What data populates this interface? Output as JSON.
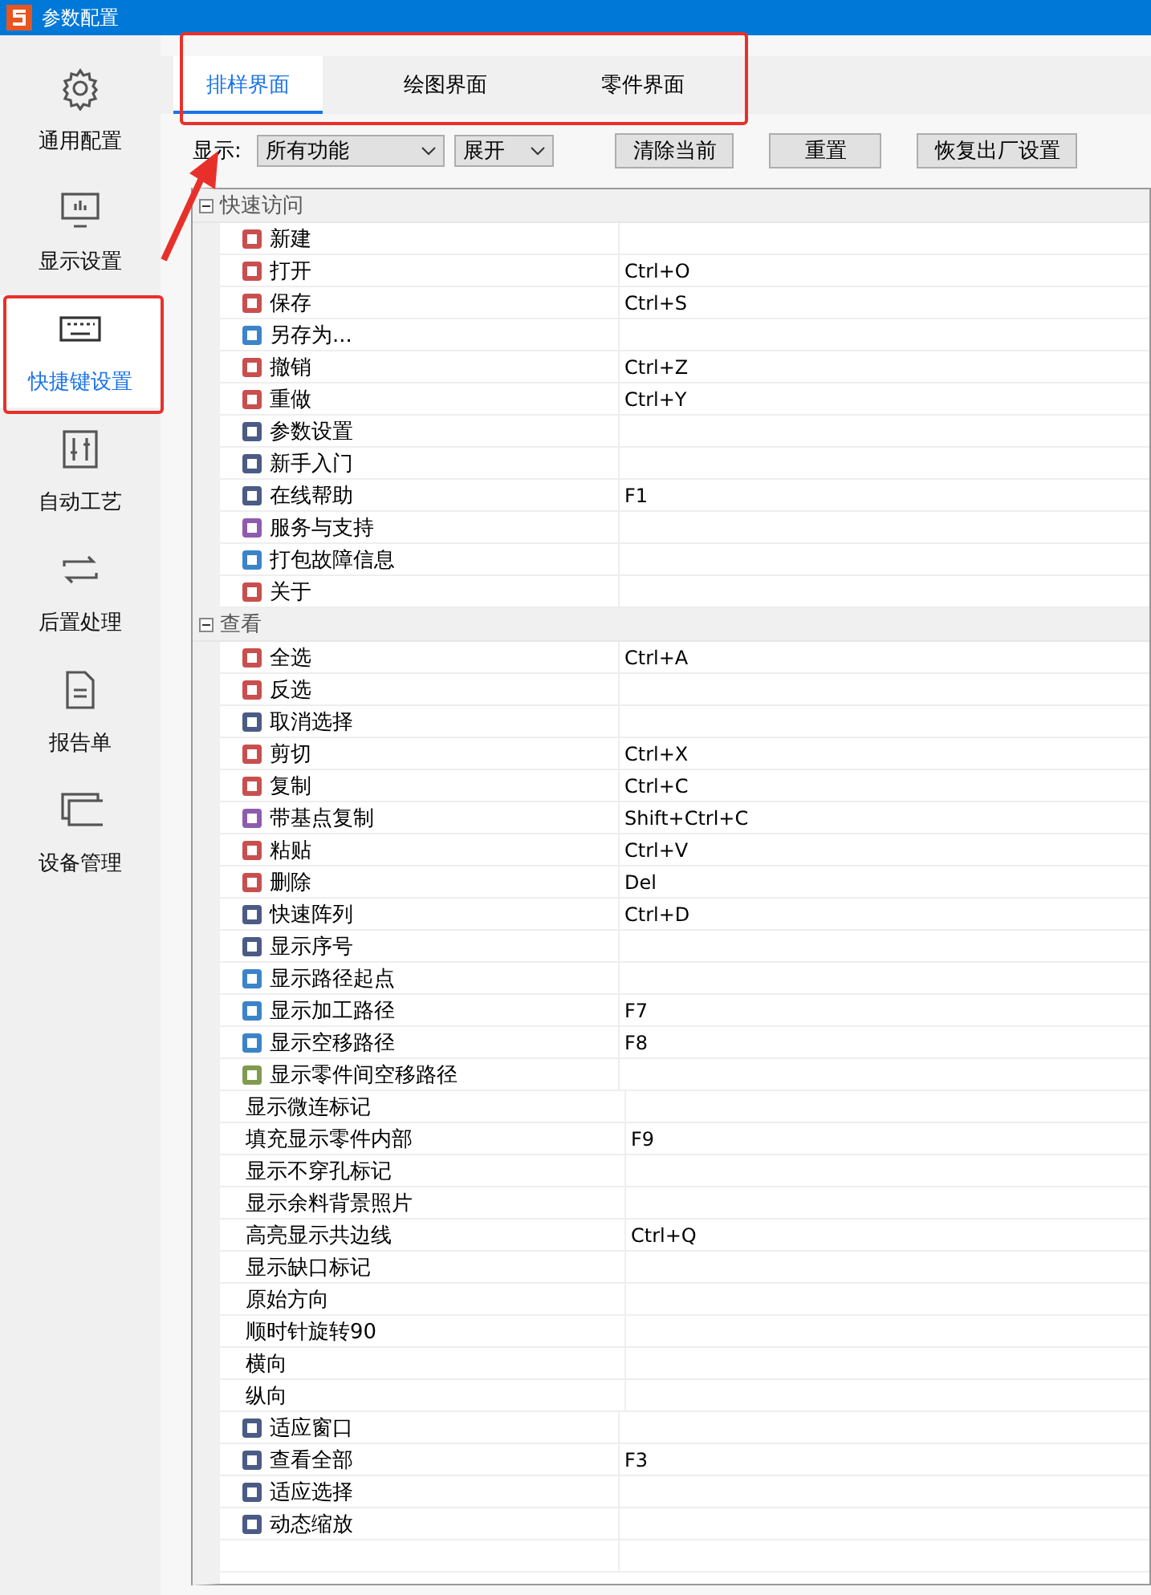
{
  "window": {
    "title": "参数配置"
  },
  "sidebar": {
    "items": [
      {
        "label": "通用配置",
        "selected": false
      },
      {
        "label": "显示设置",
        "selected": false
      },
      {
        "label": "快捷键设置",
        "selected": true
      },
      {
        "label": "自动工艺",
        "selected": false
      },
      {
        "label": "后置处理",
        "selected": false
      },
      {
        "label": "报告单",
        "selected": false
      },
      {
        "label": "设备管理",
        "selected": false
      }
    ]
  },
  "tabs": [
    {
      "label": "排样界面",
      "selected": true
    },
    {
      "label": "绘图界面",
      "selected": false
    },
    {
      "label": "零件界面",
      "selected": false
    }
  ],
  "toolbar": {
    "display_label": "显示:",
    "filter_dropdown": "所有功能",
    "expand_dropdown": "展开",
    "buttons": [
      "清除当前",
      "重置",
      "恢复出厂设置"
    ]
  },
  "groups": [
    {
      "name": "快速访问",
      "expanded": true,
      "items": [
        {
          "name": "新建",
          "has_icon": true
        },
        {
          "name": "打开",
          "shortcut": "Ctrl+O",
          "has_icon": true
        },
        {
          "name": "保存",
          "shortcut": "Ctrl+S",
          "has_icon": true
        },
        {
          "name": "另存为...",
          "has_icon": true
        },
        {
          "name": "撤销",
          "shortcut": "Ctrl+Z",
          "has_icon": true
        },
        {
          "name": "重做",
          "shortcut": "Ctrl+Y",
          "has_icon": true
        },
        {
          "name": "参数设置",
          "has_icon": true
        },
        {
          "name": "新手入门",
          "has_icon": true
        },
        {
          "name": "在线帮助",
          "shortcut": "F1",
          "has_icon": true
        },
        {
          "name": "服务与支持",
          "has_icon": true
        },
        {
          "name": "打包故障信息",
          "has_icon": true
        },
        {
          "name": "关于",
          "has_icon": true
        }
      ]
    },
    {
      "name": "查看",
      "expanded": true,
      "items": [
        {
          "name": "全选",
          "shortcut": "Ctrl+A",
          "has_icon": true
        },
        {
          "name": "反选",
          "has_icon": true
        },
        {
          "name": "取消选择",
          "has_icon": true
        },
        {
          "name": "剪切",
          "shortcut": "Ctrl+X",
          "has_icon": true
        },
        {
          "name": "复制",
          "shortcut": "Ctrl+C",
          "has_icon": true
        },
        {
          "name": "带基点复制",
          "shortcut": "Shift+Ctrl+C",
          "has_icon": true
        },
        {
          "name": "粘贴",
          "shortcut": "Ctrl+V",
          "has_icon": true
        },
        {
          "name": "删除",
          "shortcut": "Del",
          "has_icon": true
        },
        {
          "name": "快速阵列",
          "shortcut": "Ctrl+D",
          "has_icon": true
        },
        {
          "name": "显示序号",
          "has_icon": true
        },
        {
          "name": "显示路径起点",
          "has_icon": true
        },
        {
          "name": "显示加工路径",
          "shortcut": "F7",
          "has_icon": true
        },
        {
          "name": "显示空移路径",
          "shortcut": "F8",
          "has_icon": true
        },
        {
          "name": "显示零件间空移路径",
          "has_icon": true
        },
        {
          "name": "显示微连标记",
          "has_icon": false
        },
        {
          "name": "填充显示零件内部",
          "shortcut": "F9",
          "has_icon": false
        },
        {
          "name": "显示不穿孔标记",
          "has_icon": false
        },
        {
          "name": "显示余料背景照片",
          "has_icon": false
        },
        {
          "name": "高亮显示共边线",
          "shortcut": "Ctrl+Q",
          "has_icon": false
        },
        {
          "name": "显示缺口标记",
          "has_icon": false
        },
        {
          "name": "原始方向",
          "has_icon": false
        },
        {
          "name": "顺时针旋转90",
          "has_icon": false
        },
        {
          "name": "横向",
          "has_icon": false
        },
        {
          "name": "纵向",
          "has_icon": false
        },
        {
          "name": "适应窗口",
          "has_icon": true
        },
        {
          "name": "查看全部",
          "shortcut": "F3",
          "has_icon": true
        },
        {
          "name": "适应选择",
          "has_icon": true
        },
        {
          "name": "动态缩放",
          "has_icon": true
        }
      ]
    }
  ]
}
